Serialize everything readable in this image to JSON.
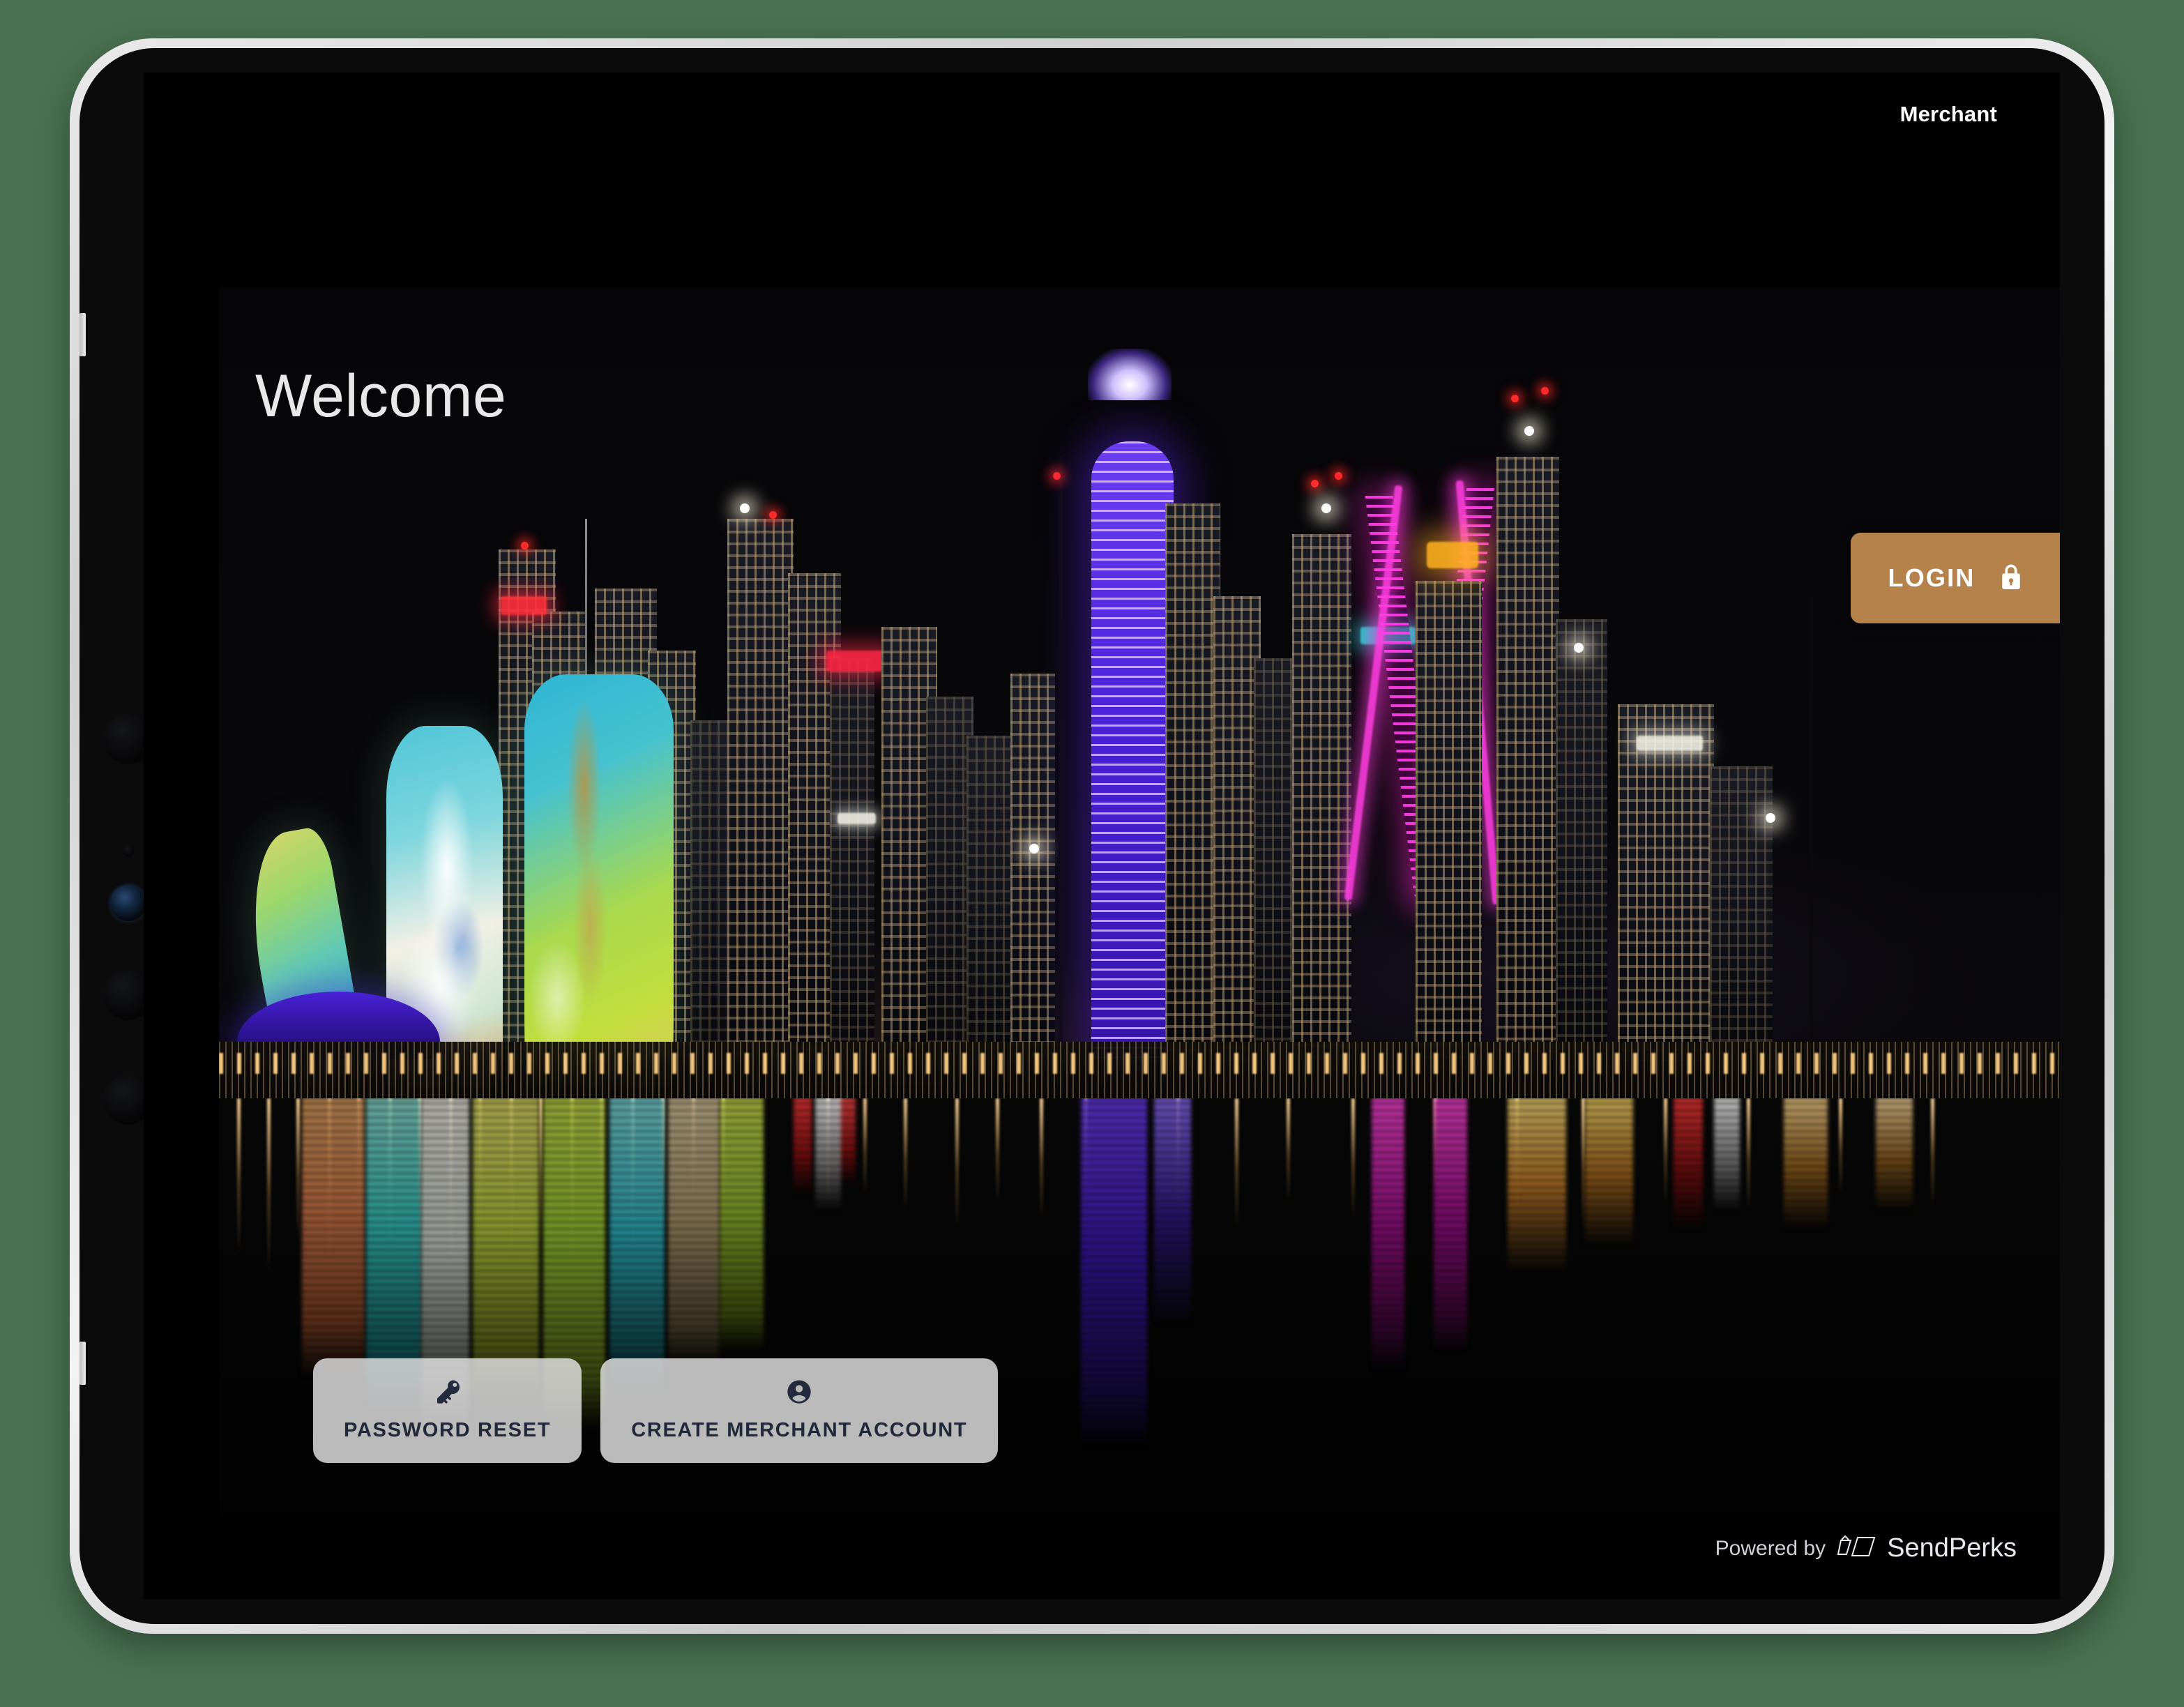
{
  "app": {
    "header": {
      "merchant_label": "Merchant"
    },
    "welcome_title": "Welcome",
    "accent_color": "#b5824b",
    "background_color": "#000000",
    "desk_color": "#4a7251"
  },
  "login": {
    "label": "LOGIN",
    "icon": "lock-icon",
    "background_color": "#b5824b",
    "text_color": "#ffffff"
  },
  "actions": [
    {
      "id": "password-reset",
      "label": "PASSWORD RESET",
      "icon": "key-icon"
    },
    {
      "id": "create-merchant-account",
      "label": "CREATE MERCHANT ACCOUNT",
      "icon": "account-circle-icon"
    }
  ],
  "footer": {
    "powered_by": "Powered by",
    "brand": "SendPerks",
    "logo_icon": "sendperks-logo-icon"
  },
  "background_photo": {
    "description": "Night skyline of Marina Bay Singapore with illuminated ArtScience Museum and water reflections",
    "alt": "Singapore Marina Bay at night"
  }
}
